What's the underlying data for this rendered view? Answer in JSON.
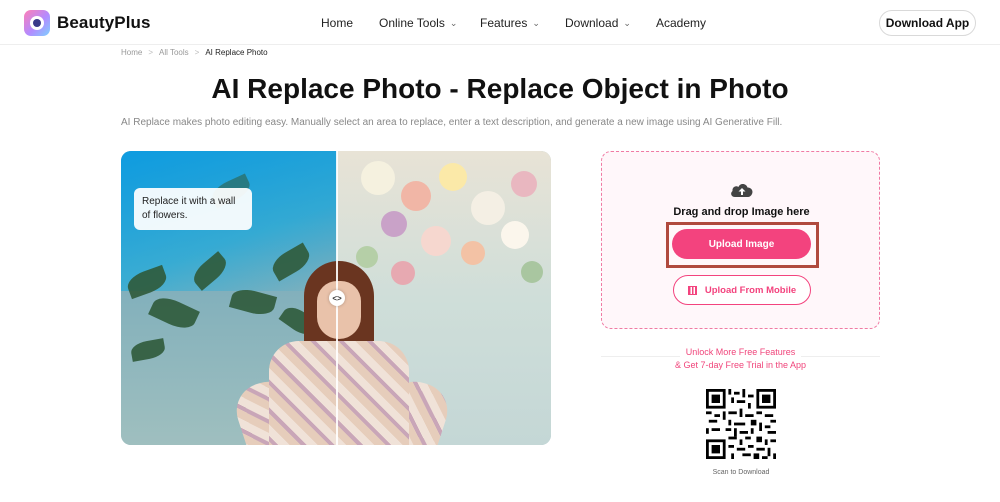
{
  "header": {
    "brand": "BeautyPlus",
    "nav": [
      {
        "label": "Home",
        "has_dropdown": false
      },
      {
        "label": "Online Tools",
        "has_dropdown": true
      },
      {
        "label": "Features",
        "has_dropdown": true
      },
      {
        "label": "Download",
        "has_dropdown": true
      },
      {
        "label": "Academy",
        "has_dropdown": false
      }
    ],
    "download_app": "Download App"
  },
  "breadcrumb": [
    "Home",
    "All Tools",
    "AI Replace Photo"
  ],
  "page_title": "AI Replace Photo - Replace Object in Photo",
  "subtitle": "AI Replace makes photo editing easy. Manually select an area to replace, enter a text description, and generate a new image using AI Generative Fill.",
  "preview": {
    "prompt_line1": "Replace it with a wall",
    "prompt_line2": "of flowers.",
    "divider_icon": "<>"
  },
  "upload": {
    "icon": "upload-cloud-icon",
    "drag_text": "Drag and drop Image here",
    "upload_button": "Upload Image",
    "mobile_button": "Upload From Mobile"
  },
  "promo": {
    "line1": "Unlock More Free Features",
    "line2": "& Get 7-day Free Trial in the App",
    "scan_label": "Scan to Download"
  },
  "colors": {
    "accent": "#f3437e",
    "highlight_border": "#b04a3e",
    "panel_bg": "#fff7fa"
  }
}
